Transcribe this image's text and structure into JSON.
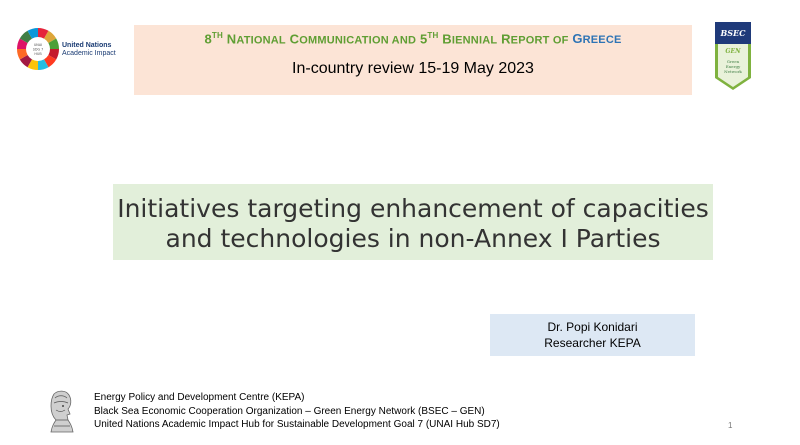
{
  "logos": {
    "un_line1": "United Nations",
    "un_line2": "Academic Impact",
    "un_ring_text": [
      "UNAI",
      "SDG 7",
      "HUB"
    ],
    "bsec_top": "BSEC",
    "bsec_mid": "GEN",
    "bsec_bottom": [
      "Green",
      "Energy",
      "Network"
    ]
  },
  "header": {
    "title_num1": "8",
    "title_sup1": "TH",
    "title_part1_cap": "N",
    "title_part1_sc": "ATIONAL",
    "title_part2_cap": "C",
    "title_part2_sc": "OMMUNICATION AND",
    "title_num2": "5",
    "title_sup2": "TH",
    "title_part3_cap": "B",
    "title_part3_sc": "IENNIAL",
    "title_part4_cap": "R",
    "title_part4_sc": "EPORT OF",
    "title_part5_cap": "G",
    "title_part5_sc": "REECE",
    "subtitle": "In-country review  15-19 May 2023"
  },
  "main": {
    "title_line1": "Initiatives targeting enhancement of capacities",
    "title_line2": "and technologies in non-Annex I Parties"
  },
  "author": {
    "name": "Dr. Popi Konidari",
    "role": "Researcher KEPA"
  },
  "footer": {
    "lines": [
      "Energy Policy and Development Centre (KEPA)",
      "Black Sea Economic Cooperation Organization – Green Energy Network (BSEC – GEN)",
      "United Nations Academic Impact Hub for Sustainable Development Goal 7 (UNAI Hub SD7)"
    ],
    "page_number": "1"
  },
  "colors": {
    "header_bg": "#fce4d6",
    "title_green": "#5f9e33",
    "title_blue": "#2e74b5",
    "main_box_bg": "#e2efda",
    "author_box_bg": "#dde8f4",
    "bsec_navy": "#1f3a7a",
    "bsec_green": "#7fb23f"
  }
}
